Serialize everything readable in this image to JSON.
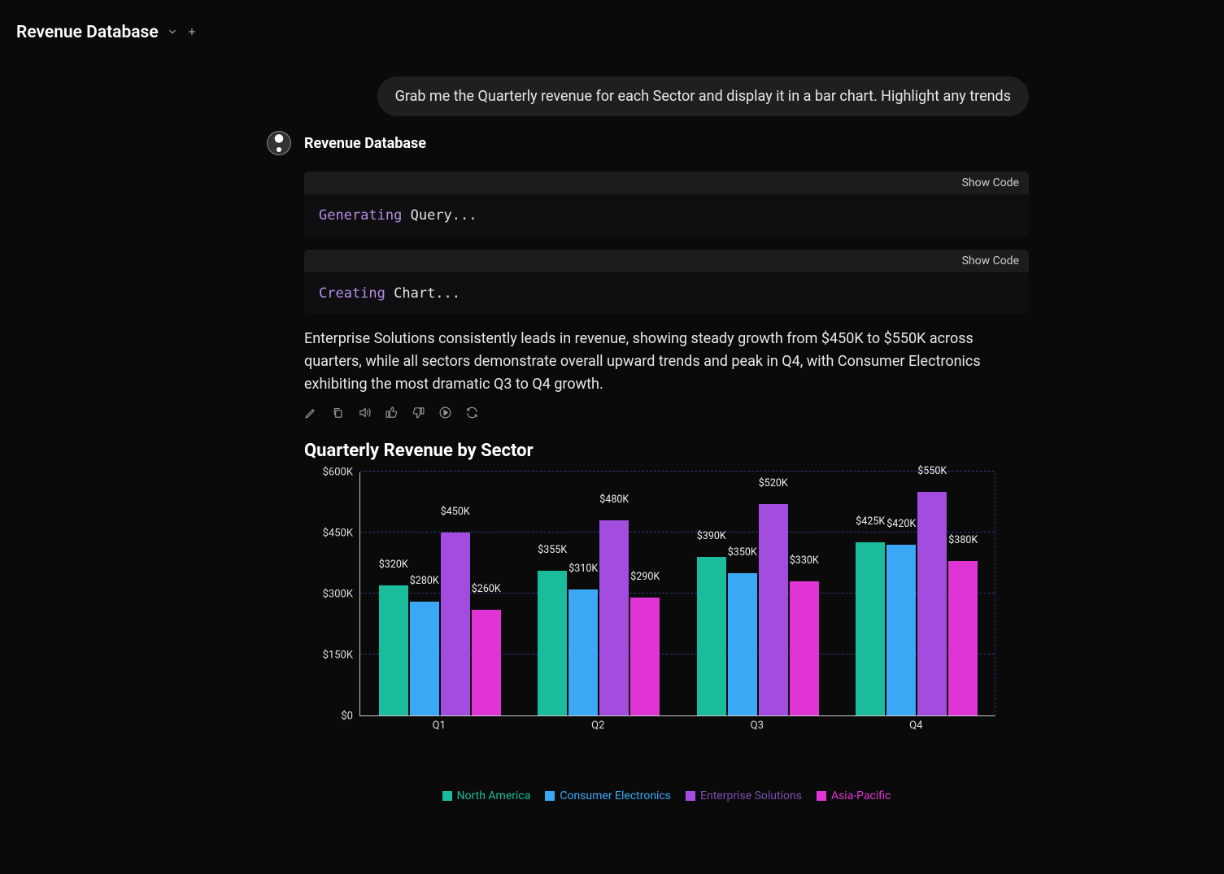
{
  "header": {
    "title": "Revenue Database"
  },
  "user_message": "Grab me the Quarterly revenue for each Sector and display it in a bar chart. Highlight any trends",
  "assistant": {
    "name": "Revenue Database",
    "panels": [
      {
        "show_code": "Show Code",
        "kw1": "Generating",
        "kw2": " Query..."
      },
      {
        "show_code": "Show Code",
        "kw1": "Creating",
        "kw2": " Chart..."
      }
    ],
    "analysis": "Enterprise Solutions consistently leads in revenue, showing steady growth from $450K to $550K across quarters, while all sectors demonstrate overall upward trends and peak in Q4, with Consumer Electronics exhibiting the most dramatic Q3 to Q4 growth."
  },
  "chart_data": {
    "type": "bar",
    "title": "Quarterly Revenue by Sector",
    "xlabel": "",
    "ylabel": "",
    "ylim": [
      0,
      600
    ],
    "yticks": [
      "$0",
      "$150K",
      "$300K",
      "$450K",
      "$600K"
    ],
    "categories": [
      "Q1",
      "Q2",
      "Q3",
      "Q4"
    ],
    "series": [
      {
        "name": "North America",
        "values": [
          320,
          355,
          390,
          425
        ],
        "labels": [
          "$320K",
          "$355K",
          "$390K",
          "$425K"
        ],
        "color": "#1abc9c"
      },
      {
        "name": "Consumer Electronics",
        "values": [
          280,
          310,
          350,
          420
        ],
        "labels": [
          "$280K",
          "$310K",
          "$350K",
          "$420K"
        ],
        "color": "#3aa8f5"
      },
      {
        "name": "Enterprise Solutions",
        "values": [
          450,
          480,
          520,
          550
        ],
        "labels": [
          "$450K",
          "$480K",
          "$520K",
          "$550K"
        ],
        "color": "#a24de0"
      },
      {
        "name": "Asia-Pacific",
        "values": [
          260,
          290,
          330,
          380
        ],
        "labels": [
          "$260K",
          "$290K",
          "$330K",
          "$380K"
        ],
        "color": "#e035d4"
      }
    ]
  }
}
